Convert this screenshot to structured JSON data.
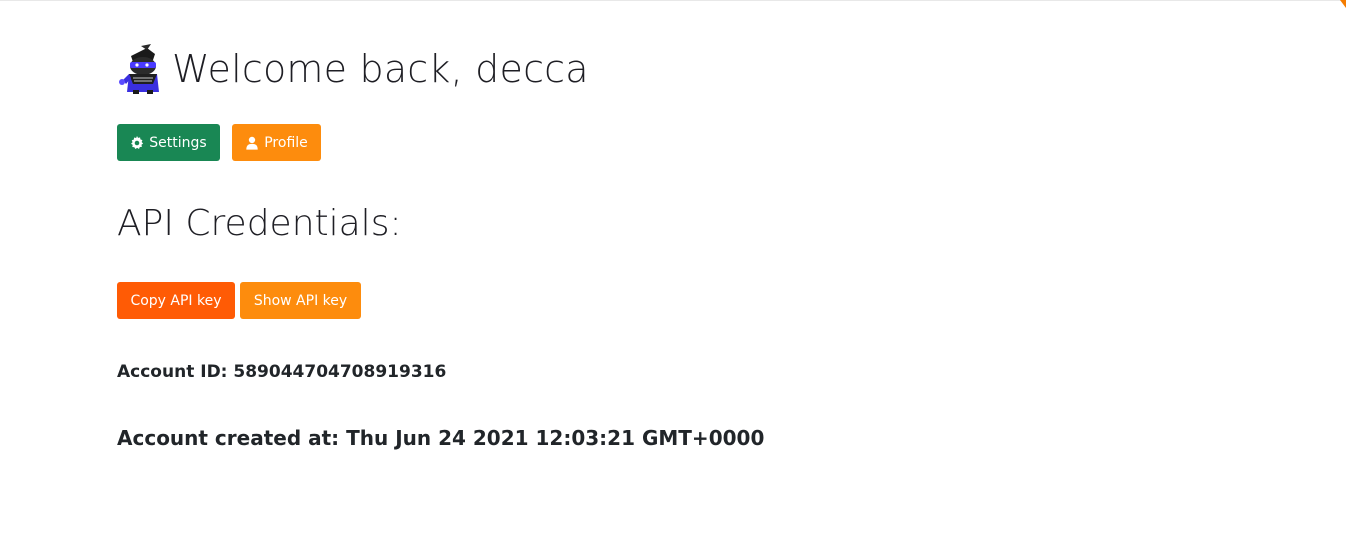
{
  "header": {
    "welcome_text": "Welcome back, decca",
    "avatar_icon": "ninja-avatar-icon"
  },
  "nav_buttons": {
    "settings_label": "Settings",
    "settings_icon": "gear-icon",
    "profile_label": "Profile",
    "profile_icon": "user-icon"
  },
  "api": {
    "title": "API Credentials:",
    "copy_label": "Copy API key",
    "show_label": "Show API key"
  },
  "account": {
    "id_text": "Account ID: 589044704708919316",
    "created_text": "Account created at: Thu Jun 24 2021 12:03:21 GMT+0000"
  },
  "colors": {
    "settings_button": "#198754",
    "profile_button": "#fd8c0d",
    "copy_button": "#ff5b05",
    "show_button": "#fd8c0d",
    "corner_accent": "#f57c00"
  }
}
